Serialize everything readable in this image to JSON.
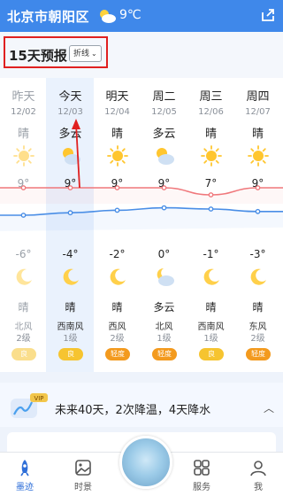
{
  "topbar": {
    "location": "北京市朝阳区",
    "temperature": "9℃",
    "weather_icon": "cloudy-sun-icon",
    "share_icon": "share-icon"
  },
  "forecast": {
    "title": "15天预报",
    "mode_label": "折线"
  },
  "colors": {
    "accent": "#3f88ea",
    "high_line": "#f0787c",
    "low_line": "#4a8ee6",
    "aqi_good": "#f6c430",
    "aqi_light": "#f39a1e"
  },
  "days": [
    {
      "day": "昨天",
      "date": "12/02",
      "cond": "晴",
      "icon": "sun-icon",
      "high": "9°",
      "low": "-6°",
      "night_icon": "moon-icon",
      "night_cond": "晴",
      "wind": "北风",
      "level": "2级",
      "aqi": "良",
      "aqi_level": "good",
      "past": true
    },
    {
      "day": "今天",
      "date": "12/03",
      "cond": "多云",
      "icon": "partly-cloudy-icon",
      "high": "9°",
      "low": "-4°",
      "night_icon": "moon-icon",
      "night_cond": "晴",
      "wind": "西南风",
      "level": "1级",
      "aqi": "良",
      "aqi_level": "good",
      "past": false
    },
    {
      "day": "明天",
      "date": "12/04",
      "cond": "晴",
      "icon": "sun-icon",
      "high": "9°",
      "low": "-2°",
      "night_icon": "moon-icon",
      "night_cond": "晴",
      "wind": "西风",
      "level": "2级",
      "aqi": "轻度",
      "aqi_level": "light",
      "past": false
    },
    {
      "day": "周二",
      "date": "12/05",
      "cond": "多云",
      "icon": "partly-cloudy-icon",
      "high": "9°",
      "low": "0°",
      "night_icon": "cloudy-moon-icon",
      "night_cond": "多云",
      "wind": "北风",
      "level": "1级",
      "aqi": "轻度",
      "aqi_level": "light",
      "past": false
    },
    {
      "day": "周三",
      "date": "12/06",
      "cond": "晴",
      "icon": "sun-icon",
      "high": "7°",
      "low": "-1°",
      "night_icon": "moon-icon",
      "night_cond": "晴",
      "wind": "西南风",
      "level": "1级",
      "aqi": "良",
      "aqi_level": "good",
      "past": false
    },
    {
      "day": "周四",
      "date": "12/07",
      "cond": "晴",
      "icon": "sun-icon",
      "high": "9°",
      "low": "-3°",
      "night_icon": "moon-icon",
      "night_cond": "晴",
      "wind": "东风",
      "level": "2级",
      "aqi": "轻度",
      "aqi_level": "light",
      "past": false
    }
  ],
  "banner": {
    "badge": "VIP",
    "text": "未来40天，2次降温，4天降水",
    "icon": "vip-trend-icon"
  },
  "bottom_nav": [
    {
      "label": "墨迹",
      "icon": "rocket-icon",
      "active": true
    },
    {
      "label": "时景",
      "icon": "photo-icon",
      "active": false
    },
    {
      "label": "服务",
      "icon": "grid-icon",
      "active": false
    },
    {
      "label": "我",
      "icon": "user-icon",
      "active": false
    }
  ]
}
